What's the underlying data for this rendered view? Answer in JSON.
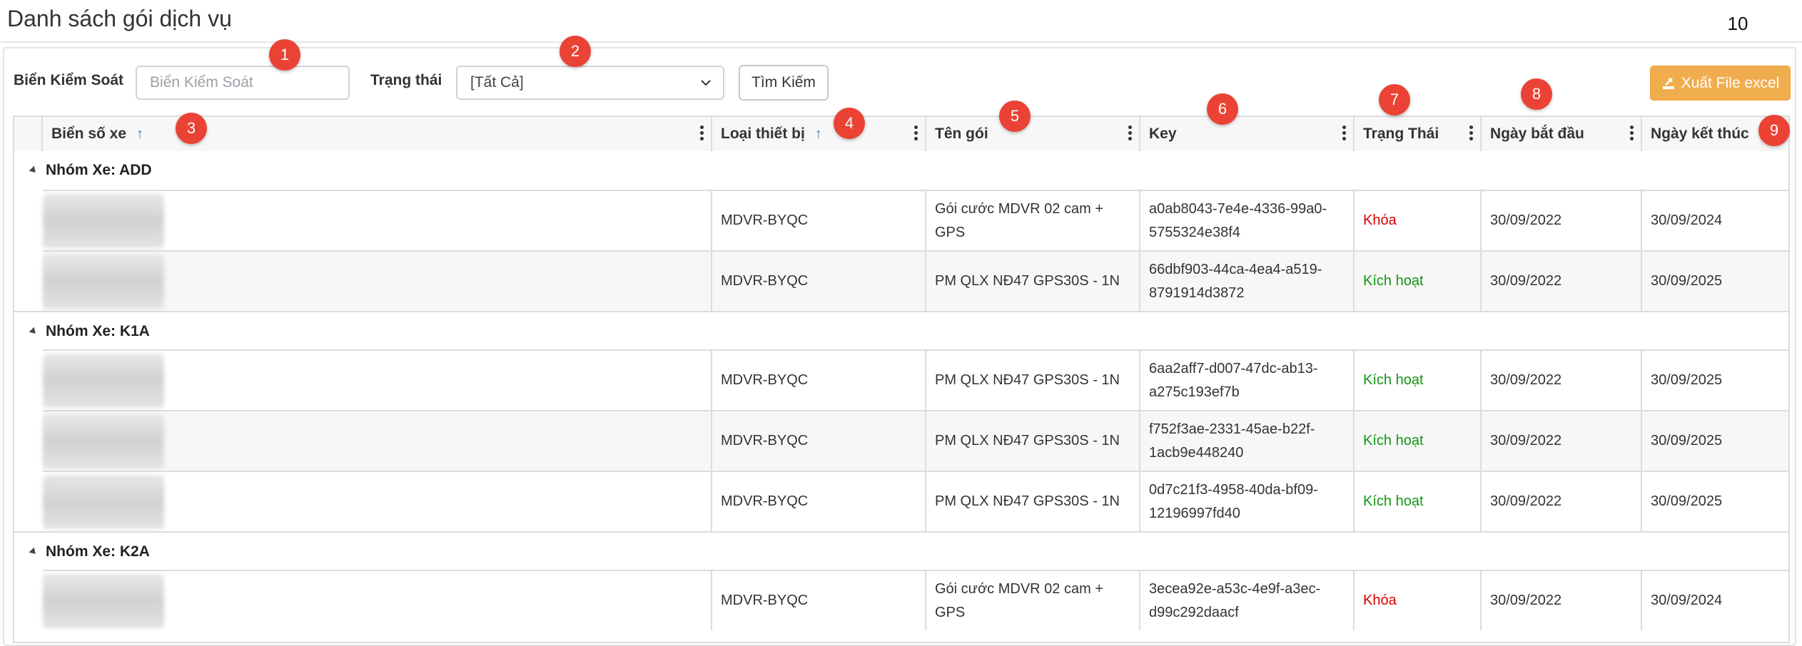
{
  "page": {
    "title": "Danh sách gói dịch vụ"
  },
  "filters": {
    "plate_label": "Biển Kiểm Soát",
    "plate_placeholder": "Biển Kiểm Soát",
    "status_label": "Trạng thái",
    "status_value": "[Tất Cả]",
    "search_button": "Tìm Kiếm",
    "export_button": "Xuất File excel"
  },
  "table": {
    "columns": [
      {
        "label": "Biển số xe",
        "sorted": "asc"
      },
      {
        "label": "Loại thiết bị",
        "sorted": "asc"
      },
      {
        "label": "Tên gói"
      },
      {
        "label": "Key"
      },
      {
        "label": "Trạng Thái"
      },
      {
        "label": "Ngày bắt đầu"
      },
      {
        "label": "Ngày kết thúc"
      }
    ],
    "groups": [
      {
        "label": "Nhóm Xe: ADD",
        "rows": [
          {
            "device": "MDVR-BYQC",
            "package": "Gói cước MDVR 02 cam + GPS",
            "key": "a0ab8043-7e4e-4336-99a0-5755324e38f4",
            "status": "Khóa",
            "start": "30/09/2022",
            "end": "30/09/2024"
          },
          {
            "device": "MDVR-BYQC",
            "package": "PM QLX NĐ47 GPS30S - 1N",
            "key": "66dbf903-44ca-4ea4-a519-8791914d3872",
            "status": "Kích hoạt",
            "start": "30/09/2022",
            "end": "30/09/2025"
          }
        ]
      },
      {
        "label": "Nhóm Xe: K1A",
        "rows": [
          {
            "device": "MDVR-BYQC",
            "package": "PM QLX NĐ47 GPS30S - 1N",
            "key": "6aa2aff7-d007-47dc-ab13-a275c193ef7b",
            "status": "Kích hoạt",
            "start": "30/09/2022",
            "end": "30/09/2025"
          },
          {
            "device": "MDVR-BYQC",
            "package": "PM QLX NĐ47 GPS30S - 1N",
            "key": "f752f3ae-2331-45ae-b22f-1acb9e448240",
            "status": "Kích hoạt",
            "start": "30/09/2022",
            "end": "30/09/2025"
          },
          {
            "device": "MDVR-BYQC",
            "package": "PM QLX NĐ47 GPS30S - 1N",
            "key": "0d7c21f3-4958-40da-bf09-12196997fd40",
            "status": "Kích hoạt",
            "start": "30/09/2022",
            "end": "30/09/2025"
          }
        ]
      },
      {
        "label": "Nhóm Xe: K2A",
        "rows": [
          {
            "device": "MDVR-BYQC",
            "package": "Gói cước MDVR 02 cam + GPS",
            "key": "3ecea92e-a53c-4e9f-a3ec-d99c292daacf",
            "status": "Khóa",
            "start": "30/09/2022",
            "end": "30/09/2024"
          }
        ]
      }
    ]
  },
  "colors": {
    "locked": "#d60000",
    "active": "#139513",
    "export": "#f0ad4e",
    "marker": "#ea4335"
  },
  "markers": [
    "1",
    "2",
    "3",
    "4",
    "5",
    "6",
    "7",
    "8",
    "9",
    "10"
  ]
}
